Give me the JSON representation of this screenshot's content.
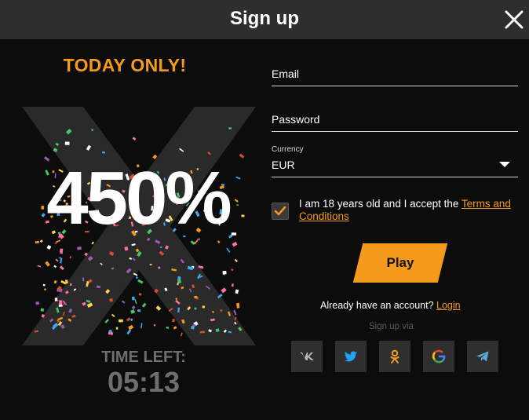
{
  "dialog": {
    "title": "Sign up"
  },
  "promo": {
    "banner": "TODAY ONLY!",
    "bonus": "450%",
    "timer_label": "TIME LEFT:",
    "timer_value": "05:13"
  },
  "form": {
    "email_label": "Email",
    "password_label": "Password",
    "currency_label": "Currency",
    "currency_value": "EUR",
    "terms_text": "I am 18 years old and I accept the ",
    "terms_link": "Terms and Conditions",
    "terms_checked": true,
    "play_label": "Play",
    "account_text": "Already have an account? ",
    "login_link": "Login",
    "signup_via": "Sign up via"
  },
  "social": {
    "icons": [
      "vk-icon",
      "twitter-icon",
      "odnoklassniki-icon",
      "google-icon",
      "telegram-icon"
    ]
  },
  "colors": {
    "accent": "#f49a1c",
    "background": "#0c0c0c",
    "header": "#2e2e2e",
    "social_tile": "#2f2f2f"
  }
}
